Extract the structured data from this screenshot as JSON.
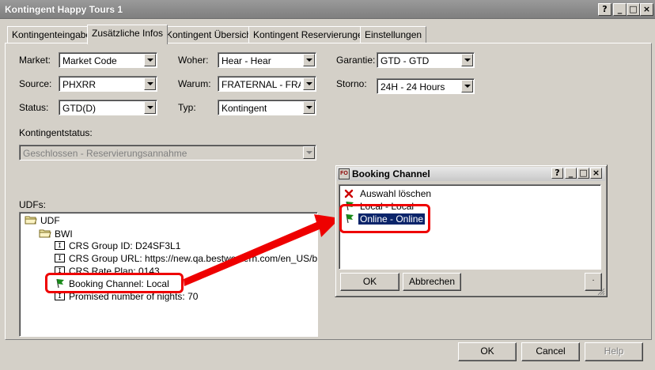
{
  "window": {
    "title": "Kontingent Happy Tours 1",
    "help_glyph": "?",
    "minimize_glyph": "_",
    "maximize_glyph": "□",
    "close_glyph": "×"
  },
  "tabs": [
    {
      "label": "Kontingenteingabe",
      "active": false
    },
    {
      "label": "Zusätzliche Infos",
      "active": true
    },
    {
      "label": "Kontingent Übersicht",
      "active": false
    },
    {
      "label": "Kontingent Reservierungen",
      "active": false
    },
    {
      "label": "Einstellungen",
      "active": false
    }
  ],
  "form": {
    "market_label": "Market:",
    "market_value": "Market Code",
    "source_label": "Source:",
    "source_value": "PHXRR",
    "status_label": "Status:",
    "status_value": "GTD(D)",
    "woher_label": "Woher:",
    "woher_value": "Hear  - Hear",
    "warum_label": "Warum:",
    "warum_value": "FRATERNAL  - FRAT",
    "typ_label": "Typ:",
    "typ_value": "Kontingent",
    "garantie_label": "Garantie:",
    "garantie_value": "GTD  - GTD",
    "storno_label": "Storno:",
    "storno_value": "24H  - 24 Hours",
    "kontingentstatus_label": "Kontingentstatus:",
    "kontingentstatus_value": "Geschlossen - Reservierungsannahme",
    "udfs_label": "UDFs:"
  },
  "tree": {
    "root": "UDF",
    "group": "BWI",
    "items": [
      {
        "icon": "text-field-icon",
        "label": "CRS Group ID: D24SF3L1"
      },
      {
        "icon": "text-field-icon",
        "label": "CRS Group URL: https://new.qa.bestwestern.com/en_US/book/l"
      },
      {
        "icon": "text-field-icon",
        "label": "CRS Rate Plan: 0143"
      },
      {
        "icon": "green-flag-icon",
        "label": "Booking Channel: Local"
      },
      {
        "icon": "text-field-icon",
        "label": "Promised number of nights: 70"
      }
    ]
  },
  "buttons": {
    "ok": "OK",
    "cancel": "Cancel",
    "help": "Help"
  },
  "dialog": {
    "app_icon": "FO",
    "title": "Booking Channel",
    "help_glyph": "?",
    "minimize_glyph": "_",
    "maximize_glyph": "□",
    "close_glyph": "×",
    "options": [
      {
        "icon": "red-x-icon",
        "label": "Auswahl löschen",
        "selected": false
      },
      {
        "icon": "green-flag-icon",
        "label": "Local - Local",
        "selected": false
      },
      {
        "icon": "green-flag-icon",
        "label": "Online - Online",
        "selected": true
      }
    ],
    "ok": "OK",
    "cancel": "Abbrechen",
    "extra": "."
  },
  "colors": {
    "annotation_red": "#ee0000",
    "selection_blue": "#0a246a",
    "flag_green": "#1a8a1a"
  }
}
